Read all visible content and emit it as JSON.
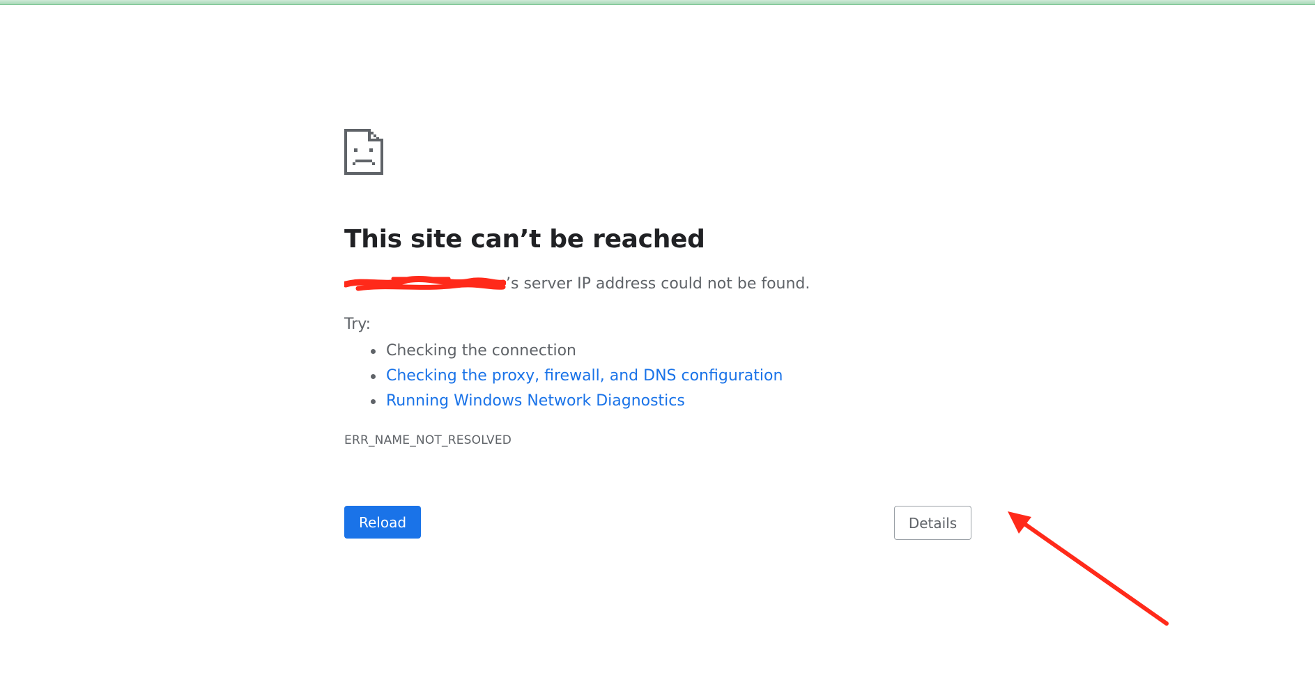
{
  "page": {
    "title": "This site can’t be reached",
    "description_suffix": "’s server IP address could not be found.",
    "try_label": "Try:",
    "suggestions": [
      {
        "label": "Checking the connection",
        "is_link": false
      },
      {
        "label": "Checking the proxy, firewall, and DNS configuration",
        "is_link": true
      },
      {
        "label": "Running Windows Network Diagnostics",
        "is_link": true
      }
    ],
    "error_code": "ERR_NAME_NOT_RESOLVED",
    "reload_label": "Reload",
    "details_label": "Details"
  },
  "icons": {
    "error_page": "sad-document-icon",
    "annotation": "red-arrow-annotation"
  },
  "colors": {
    "link": "#1a73e8",
    "primary_button": "#1a73e8",
    "heading": "#202124",
    "body_text": "#5f6368",
    "redaction": "#ff2a1a",
    "top_strip": "#a8d9b7"
  }
}
